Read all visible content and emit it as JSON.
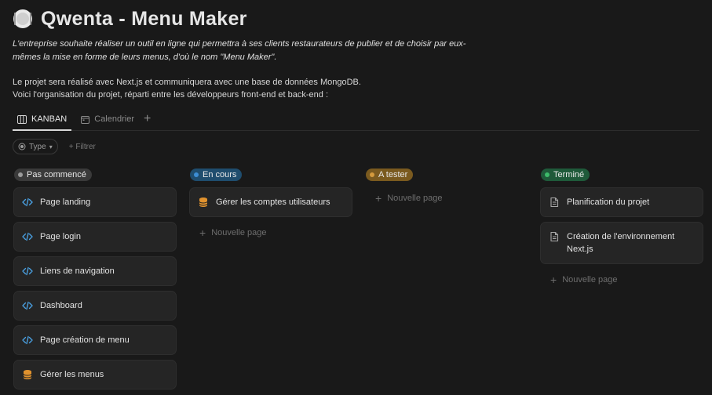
{
  "header": {
    "title": "Qwenta - Menu Maker",
    "description": "L'entreprise souhaite réaliser un outil en ligne qui permettra à ses clients restaurateurs de publier et de choisir par eux-mêmes la mise en forme de leurs menus, d'où le nom \"Menu Maker\".",
    "paragraph1": "Le projet sera réalisé avec Next.js et communiquera avec une base de données MongoDB.",
    "paragraph2": "Voici l'organisation du projet, réparti entre les développeurs front-end et back-end :"
  },
  "tabs": [
    {
      "label": "KANBAN",
      "icon": "board-icon",
      "active": true
    },
    {
      "label": "Calendrier",
      "icon": "calendar-icon",
      "active": false
    }
  ],
  "filters": {
    "type_label": "Type",
    "add_filter_label": "Filtrer"
  },
  "new_page_label": "Nouvelle page",
  "columns": [
    {
      "status": "Pas commencé",
      "badge_color": "#3a3a3a",
      "dot_color": "#9b9b9b",
      "cards": [
        {
          "label": "Page landing",
          "icon": "code-icon"
        },
        {
          "label": "Page login",
          "icon": "code-icon"
        },
        {
          "label": "Liens de navigation",
          "icon": "code-icon"
        },
        {
          "label": "Dashboard",
          "icon": "code-icon"
        },
        {
          "label": "Page création de menu",
          "icon": "code-icon"
        },
        {
          "label": "Gérer les menus",
          "icon": "database-icon"
        }
      ]
    },
    {
      "status": "En cours",
      "badge_color": "#1f4d6e",
      "dot_color": "#3d8ed4",
      "cards": [
        {
          "label": "Gérer les comptes utilisateurs",
          "icon": "database-icon"
        }
      ]
    },
    {
      "status": "A tester",
      "badge_color": "#7a5a1f",
      "dot_color": "#d49a3d",
      "cards": []
    },
    {
      "status": "Terminé",
      "badge_color": "#1f5a3a",
      "dot_color": "#3dba6a",
      "cards": [
        {
          "label": "Planification du projet",
          "icon": "document-icon"
        },
        {
          "label": "Création de l'environnement Next.js",
          "icon": "document-icon"
        }
      ]
    }
  ]
}
